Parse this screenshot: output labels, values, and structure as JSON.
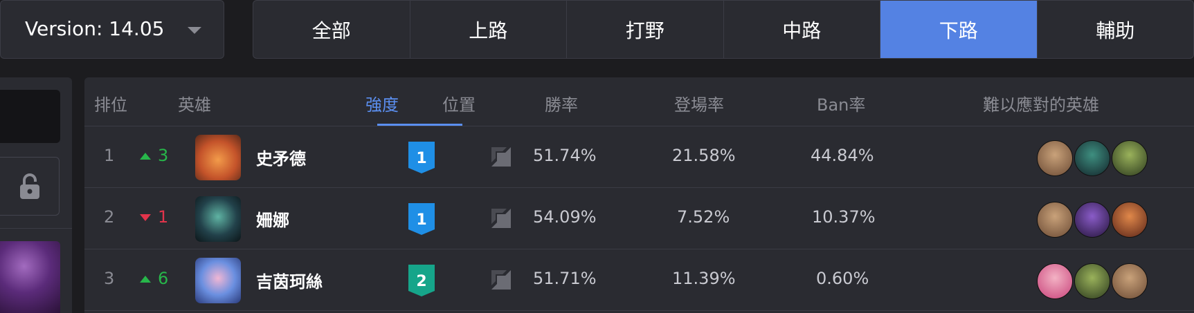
{
  "version": {
    "label": "Version: 14.05"
  },
  "tabs": [
    {
      "label": "全部",
      "active": false
    },
    {
      "label": "上路",
      "active": false
    },
    {
      "label": "打野",
      "active": false
    },
    {
      "label": "中路",
      "active": false
    },
    {
      "label": "下路",
      "active": true
    },
    {
      "label": "輔助",
      "active": false
    }
  ],
  "colors": {
    "accent": "#5482e3",
    "up": "#27b64a",
    "down": "#e2344b",
    "tier1": "#1f8fe6",
    "tier2": "#16a58a"
  },
  "table": {
    "headers": {
      "rank": "排位",
      "champion": "英雄",
      "strength": "強度",
      "position": "位置",
      "winrate": "勝率",
      "pickrate": "登場率",
      "banrate": "Ban率",
      "counters": "難以應對的英雄"
    },
    "rows": [
      {
        "rank": "1",
        "trend": "up",
        "trend_value": "3",
        "name": "史矛德",
        "tier": "1",
        "winrate": "51.74%",
        "pickrate": "21.58%",
        "banrate": "44.84%",
        "position_icon": "bottom-lane-icon"
      },
      {
        "rank": "2",
        "trend": "down",
        "trend_value": "1",
        "name": "姍娜",
        "tier": "1",
        "winrate": "54.09%",
        "pickrate": "7.52%",
        "banrate": "10.37%",
        "position_icon": "bottom-lane-icon"
      },
      {
        "rank": "3",
        "trend": "up",
        "trend_value": "6",
        "name": "吉茵珂絲",
        "tier": "2",
        "winrate": "51.71%",
        "pickrate": "11.39%",
        "banrate": "0.60%",
        "position_icon": "bottom-lane-icon"
      }
    ]
  }
}
